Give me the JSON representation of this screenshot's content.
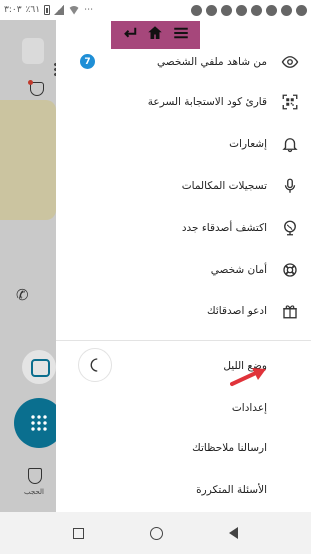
{
  "status_bar": {
    "time": "٣:٠٣",
    "battery": "٪٦١",
    "more": "⋯",
    "icons": [
      "whatsapp-icon",
      "gmail-icon",
      "facebook-icon",
      "facebook-icon",
      "facebook-icon",
      "twitter-icon",
      "youtube-icon",
      "amazon-icon",
      "wifi-icon",
      "signal-icon",
      "battery-icon"
    ]
  },
  "toolbar": {
    "icons": [
      "menu-icon",
      "home-icon",
      "enter-icon"
    ],
    "color": "#a6477b"
  },
  "background_app": {
    "bottom_label": "الحجب",
    "colors": {
      "fab": "#0a6f8f"
    }
  },
  "drawer": {
    "items": [
      {
        "label": "من شاهد ملفي الشخصي",
        "icon": "eye-icon",
        "badge": "7"
      },
      {
        "label": "قارئ كود الاستجابة السرعة",
        "icon": "qr-scan-icon"
      },
      {
        "label": "إشعارات",
        "icon": "bell-icon"
      },
      {
        "label": "تسجيلات المكالمات",
        "icon": "microphone-icon"
      },
      {
        "label": "اكتشف أصدقاء جدد",
        "icon": "globe-icon"
      },
      {
        "label": "أمان شخصي",
        "icon": "lifebuoy-icon"
      },
      {
        "label": "ادعو اصدقائك",
        "icon": "gift-icon"
      }
    ],
    "night_mode": {
      "label": "وضع الليل",
      "icon": "moon-icon"
    },
    "settings": {
      "label": "إعدادات"
    },
    "feedback": {
      "label": "ارسالنا ملاحظاتك"
    },
    "faq": {
      "label": "الأسئلة المتكررة"
    },
    "badge_color": "#1f8fd6"
  },
  "annotation": {
    "arrow_color": "#e0333a"
  },
  "nav_bar": {
    "icons": [
      "recents-icon",
      "home-circle-icon",
      "back-icon"
    ]
  }
}
